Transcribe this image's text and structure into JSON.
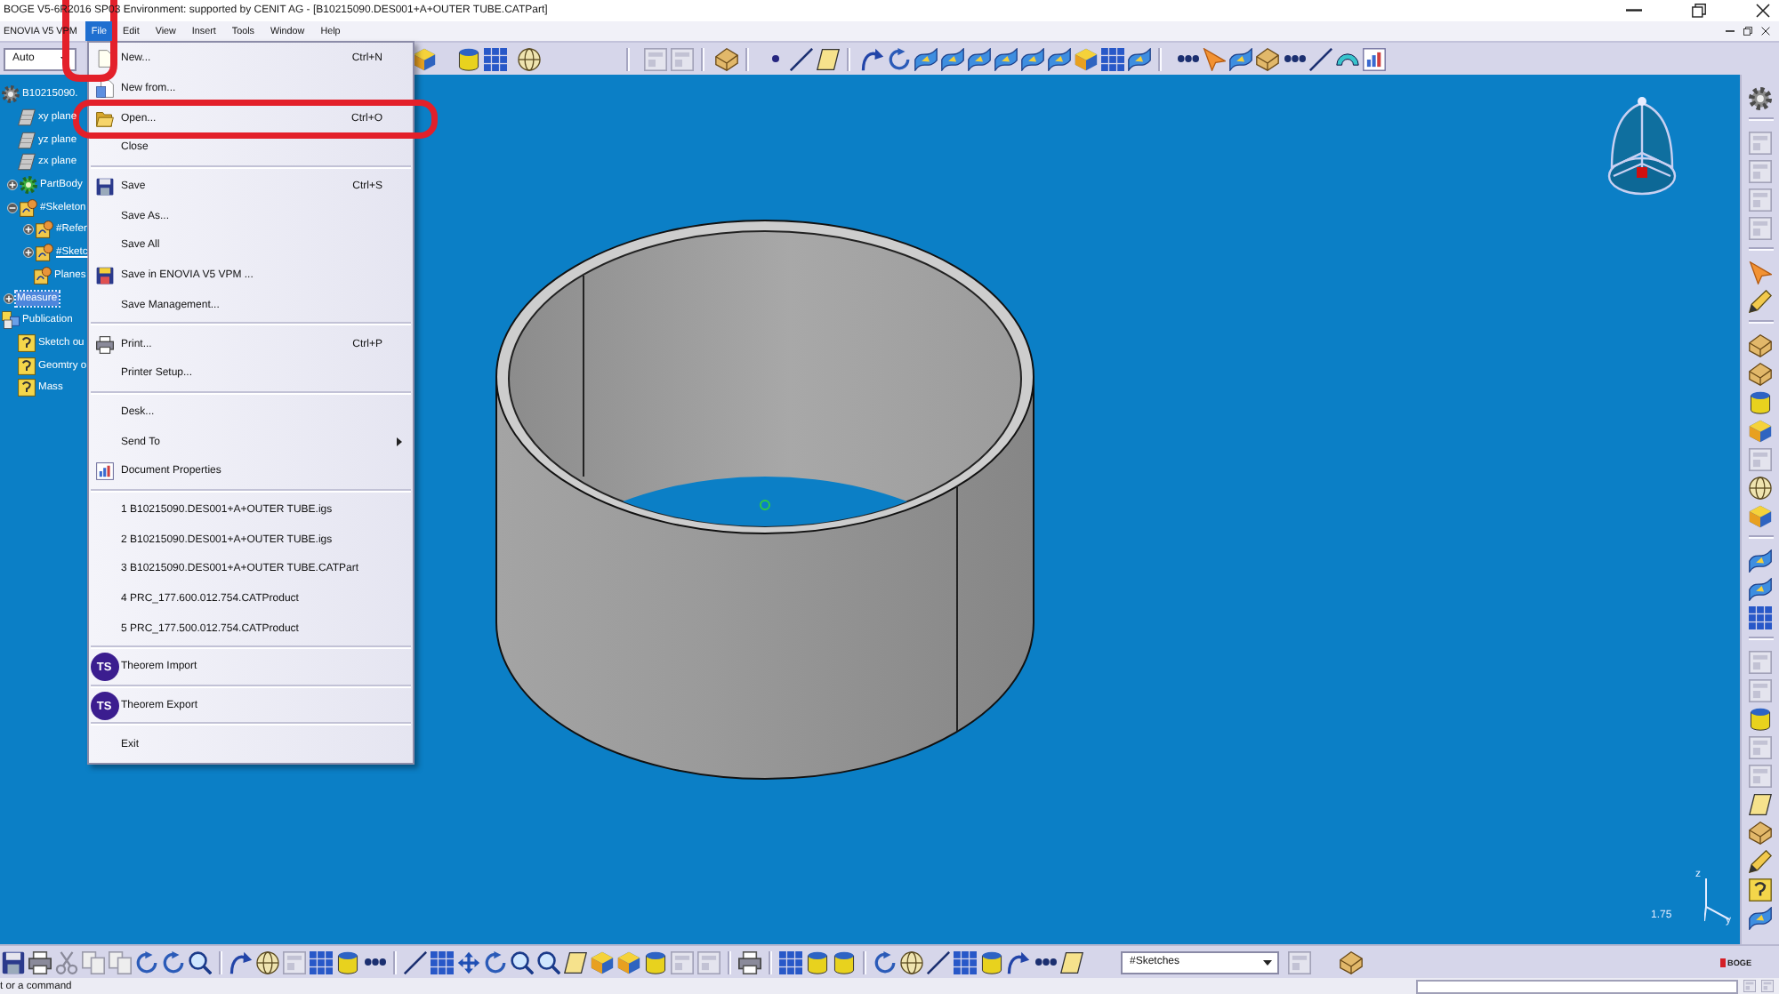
{
  "window": {
    "title": "BOGE V5-6R2016 SP03 Environment: supported by CENIT AG - [B10215090.DES001+A+OUTER TUBE.CATPart]"
  },
  "menu_bar": {
    "items": [
      {
        "label": "ENOVIA V5 VPM",
        "selected": false
      },
      {
        "label": "File",
        "selected": true
      },
      {
        "label": "Edit",
        "selected": false
      },
      {
        "label": "View",
        "selected": false
      },
      {
        "label": "Insert",
        "selected": false
      },
      {
        "label": "Tools",
        "selected": false
      },
      {
        "label": "Window",
        "selected": false
      },
      {
        "label": "Help",
        "selected": false
      }
    ]
  },
  "toolbar": {
    "workbench": {
      "value": "Auto"
    }
  },
  "tree": [
    {
      "label": "B10215090.",
      "kind": "part",
      "selected": false,
      "in_work": false,
      "children": [
        {
          "label": "xy plane",
          "kind": "plane",
          "selected": false,
          "in_work": false
        },
        {
          "label": "yz plane",
          "kind": "plane",
          "selected": false,
          "in_work": false
        },
        {
          "label": "zx plane",
          "kind": "plane",
          "selected": false,
          "in_work": false
        },
        {
          "label": "PartBody",
          "kind": "body",
          "selected": false,
          "in_work": false,
          "expanded": false
        },
        {
          "label": "#Skeleton",
          "kind": "skeleton",
          "selected": false,
          "in_work": false,
          "expanded": true,
          "children": [
            {
              "label": "#Refer",
              "kind": "skeleton",
              "selected": false,
              "in_work": false,
              "expanded": false
            },
            {
              "label": "#Sketc",
              "kind": "skeleton",
              "selected": false,
              "in_work": true,
              "expanded": false
            },
            {
              "label": "Planes",
              "kind": "skeleton",
              "selected": false,
              "in_work": false
            }
          ]
        }
      ]
    },
    {
      "label": "Measure",
      "kind": "measure",
      "selected": true,
      "in_work": false,
      "expanded": false
    },
    {
      "label": "Publication",
      "kind": "publication",
      "selected": false,
      "in_work": false,
      "children": [
        {
          "label": "Sketch ou",
          "kind": "published",
          "selected": false,
          "in_work": false
        },
        {
          "label": "Geomtry o",
          "kind": "published",
          "selected": false,
          "in_work": false
        },
        {
          "label": "Mass",
          "kind": "published",
          "selected": false,
          "in_work": false
        }
      ]
    }
  ],
  "file_menu": {
    "items": [
      {
        "kind": "item",
        "label": "New...",
        "shortcut": "Ctrl+N"
      },
      {
        "kind": "item",
        "label": "New from..."
      },
      {
        "kind": "item",
        "label": "Open...",
        "shortcut": "Ctrl+O"
      },
      {
        "kind": "item",
        "label": "Close"
      },
      {
        "kind": "separator"
      },
      {
        "kind": "item",
        "label": "Save",
        "shortcut": "Ctrl+S"
      },
      {
        "kind": "item",
        "label": "Save As..."
      },
      {
        "kind": "item",
        "label": "Save All"
      },
      {
        "kind": "item",
        "label": "Save in ENOVIA V5 VPM ..."
      },
      {
        "kind": "item",
        "label": "Save Management..."
      },
      {
        "kind": "separator"
      },
      {
        "kind": "item",
        "label": "Print...",
        "shortcut": "Ctrl+P"
      },
      {
        "kind": "item",
        "label": "Printer Setup..."
      },
      {
        "kind": "separator"
      },
      {
        "kind": "item",
        "label": "Desk..."
      },
      {
        "kind": "submenu",
        "label": "Send To"
      },
      {
        "kind": "item",
        "label": "Document Properties"
      },
      {
        "kind": "separator"
      },
      {
        "kind": "item",
        "label": "1 B10215090.DES001+A+OUTER TUBE.igs"
      },
      {
        "kind": "item",
        "label": "2 B10215090.DES001+A+OUTER TUBE.igs"
      },
      {
        "kind": "item",
        "label": "3 B10215090.DES001+A+OUTER TUBE.CATPart"
      },
      {
        "kind": "item",
        "label": "4 PRC_177.600.012.754.CATProduct"
      },
      {
        "kind": "item",
        "label": "5 PRC_177.500.012.754.CATProduct"
      },
      {
        "kind": "separator"
      },
      {
        "kind": "item",
        "label": "Theorem Import",
        "badge": "TS"
      },
      {
        "kind": "separator"
      },
      {
        "kind": "item",
        "label": "Theorem Export",
        "badge": "TS"
      },
      {
        "kind": "separator"
      },
      {
        "kind": "item",
        "label": "Exit"
      }
    ]
  },
  "viewport": {
    "scale": "1.75",
    "axis_labels": [
      "z",
      "y"
    ]
  },
  "bottom_toolbar": {
    "sketch_filter": {
      "value": "#Sketches"
    },
    "logo": "BOGE"
  },
  "status_bar": {
    "message": "t or a command"
  }
}
